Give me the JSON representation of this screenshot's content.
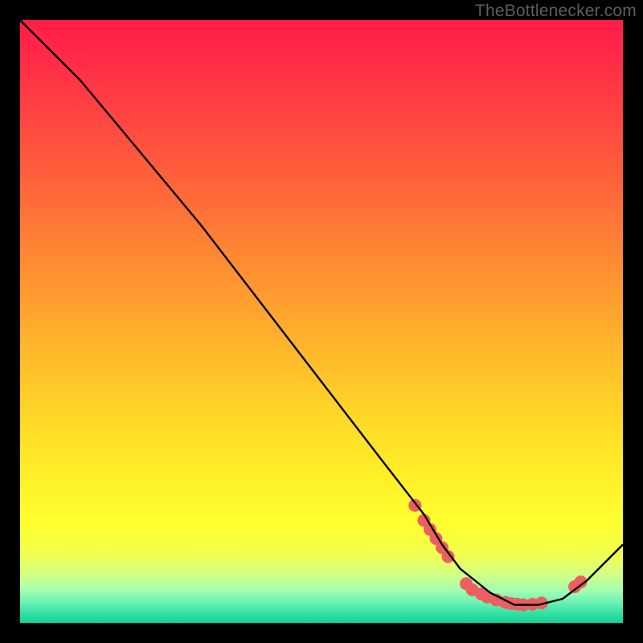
{
  "attribution": "TheBottlenecker.com",
  "chart_data": {
    "type": "line",
    "title": "",
    "xlabel": "",
    "ylabel": "",
    "xlim": [
      0,
      100
    ],
    "ylim": [
      0,
      100
    ],
    "series": [
      {
        "name": "bottleneck-curve",
        "x": [
          0,
          6,
          10,
          20,
          30,
          40,
          50,
          60,
          67,
          70,
          73,
          78,
          82,
          86,
          90,
          94,
          100
        ],
        "y": [
          100,
          94,
          90,
          78,
          66,
          53,
          40,
          27,
          18,
          13,
          9,
          5,
          3,
          3,
          4,
          7,
          13
        ]
      }
    ],
    "markers": [
      {
        "x": 65.5,
        "y": 19.5
      },
      {
        "x": 67.0,
        "y": 17.0
      },
      {
        "x": 68.0,
        "y": 15.5
      },
      {
        "x": 69.0,
        "y": 14.0
      },
      {
        "x": 70.0,
        "y": 12.5
      },
      {
        "x": 71.0,
        "y": 11.0
      },
      {
        "x": 74.0,
        "y": 6.5
      },
      {
        "x": 75.0,
        "y": 5.5
      },
      {
        "x": 76.5,
        "y": 4.8
      },
      {
        "x": 77.5,
        "y": 4.3
      },
      {
        "x": 79.0,
        "y": 3.8
      },
      {
        "x": 80.5,
        "y": 3.4
      },
      {
        "x": 81.5,
        "y": 3.2
      },
      {
        "x": 82.5,
        "y": 3.1
      },
      {
        "x": 83.5,
        "y": 3.0
      },
      {
        "x": 85.0,
        "y": 3.1
      },
      {
        "x": 86.5,
        "y": 3.3
      },
      {
        "x": 92.0,
        "y": 6.0
      },
      {
        "x": 93.0,
        "y": 6.8
      }
    ],
    "gradient_stops": [
      {
        "offset": 0.0,
        "color": "#ff1d48"
      },
      {
        "offset": 0.07,
        "color": "#ff2c47"
      },
      {
        "offset": 0.18,
        "color": "#ff4a40"
      },
      {
        "offset": 0.3,
        "color": "#ff6c39"
      },
      {
        "offset": 0.42,
        "color": "#ff9131"
      },
      {
        "offset": 0.55,
        "color": "#ffb82b"
      },
      {
        "offset": 0.66,
        "color": "#ffd828"
      },
      {
        "offset": 0.76,
        "color": "#fff028"
      },
      {
        "offset": 0.835,
        "color": "#ffff2f"
      },
      {
        "offset": 0.88,
        "color": "#f4ff4a"
      },
      {
        "offset": 0.905,
        "color": "#e2ff6c"
      },
      {
        "offset": 0.925,
        "color": "#c9ff8e"
      },
      {
        "offset": 0.945,
        "color": "#a5ffae"
      },
      {
        "offset": 0.965,
        "color": "#6ef2b5"
      },
      {
        "offset": 0.985,
        "color": "#31e0a4"
      },
      {
        "offset": 1.0,
        "color": "#14d297"
      }
    ],
    "marker_style": {
      "fill": "#ec5f5f",
      "r": 8
    },
    "line_style": {
      "stroke": "#000000",
      "width": 2.4
    }
  }
}
